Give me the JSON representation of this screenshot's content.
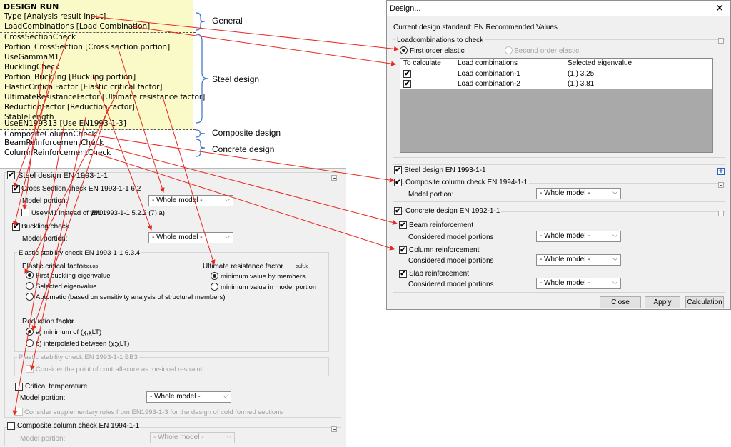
{
  "param_list": {
    "title": "DESIGN RUN",
    "lines": [
      "Type [Analysis result input]",
      "LoadCombinations [Load Combination]",
      "CrossSectionCheck",
      "Portion_CrossSection [Cross section portion]",
      "UseGammaM1",
      "BucklingCheck",
      "Portion_Buckling [Buckling portion]",
      "ElasticCriticalFactor [Elastic critical factor]",
      "UltimateResistanceFactor [Ultimate resistance factor]",
      "ReductionFactor [Reduction factor]",
      "StableLength",
      "UseEN199313 [Use EN1993-1-3]",
      "CompositeColumnCheck",
      "BeamReinforcementCheck",
      "ColumnReinforcementCheck"
    ],
    "categories": {
      "general": "General",
      "steel": "Steel design",
      "composite": "Composite design",
      "concrete": "Concrete design"
    }
  },
  "left_panel": {
    "steel_design": "Steel design EN 1993-1-1",
    "cross_section_check": "Cross Section check EN 1993-1-1 6.2",
    "model_portion_label": "Model portion:",
    "whole_model": "- Whole model -",
    "use_gamma_pre": "Use",
    "use_gamma_mid": "γM1 instead of γM0",
    "use_gamma_post": "EN 1993-1-1 5.2.2 (7) a)",
    "buckling_check": "Buckling check",
    "elastic_stability": "Elastic stability check EN 1993-1-1 6.3.4",
    "elastic_critical_factor": "Elastic critical factor",
    "elastic_critical_sym": "αcr,op",
    "first_buckling": "First buckling eigenvalue",
    "selected_eigenvalue": "Selected eigenvalue",
    "automatic": "Automatic (based on sensitivity analysis of structural members)",
    "ultimate_resistance": "Ultimate resistance factor",
    "ultimate_sym": "αult,k",
    "min_by_members": "minimum value by members",
    "min_in_portion": "minimum value in model portion",
    "reduction_factor": "Reduction factor",
    "reduction_sym": "χop",
    "option_a": "a) minimum of (χ;χLT)",
    "option_b": "b) interpolated between (χ;χLT)",
    "plastic_stability": "Plastic stability check EN 1993-1-1 BB3",
    "contraflexure": "Consider the point of contraflexure as torsional restraint",
    "critical_temperature": "Critical temperature",
    "cold_formed": "Consider supplementary rules from EN1993-1-3 for the design of cold formed sections",
    "composite_column": "Composite column check EN 1994-1-1"
  },
  "dialog": {
    "title": "Design...",
    "close_glyph": "✕",
    "standard": "Current design standard: EN Recommended Values",
    "loadcomb_group": "Loadcombinations to check",
    "first_order": "First order elastic",
    "second_order": "Second order elastic",
    "table": {
      "headers": [
        "To calculate",
        "Load combinations",
        "Selected eigenvalue"
      ],
      "rows": [
        {
          "check": "✔",
          "name": "Load combination-1",
          "eigen": "(1.)  3,25"
        },
        {
          "check": "✔",
          "name": "Load combination-2",
          "eigen": "(1.)  3,81"
        }
      ]
    },
    "steel_design": "Steel design EN 1993-1-1",
    "composite_column": "Composite column check EN 1994-1-1",
    "model_portion_label": "Model portion:",
    "whole_model": "- Whole model -",
    "concrete_design": "Concrete design EN 1992-1-1",
    "beam_reinforcement": "Beam reinforcement",
    "column_reinforcement": "Column reinforcement",
    "slab_reinforcement": "Slab reinforcement",
    "considered_portions": "Considered model portions",
    "buttons": {
      "close": "Close",
      "apply": "Apply",
      "calculation": "Calculation"
    }
  },
  "colors": {
    "arrow": "#e8271f",
    "brace": "#3a6fc4",
    "highlight": "#fafac8",
    "accent": "#2c5fb5"
  }
}
